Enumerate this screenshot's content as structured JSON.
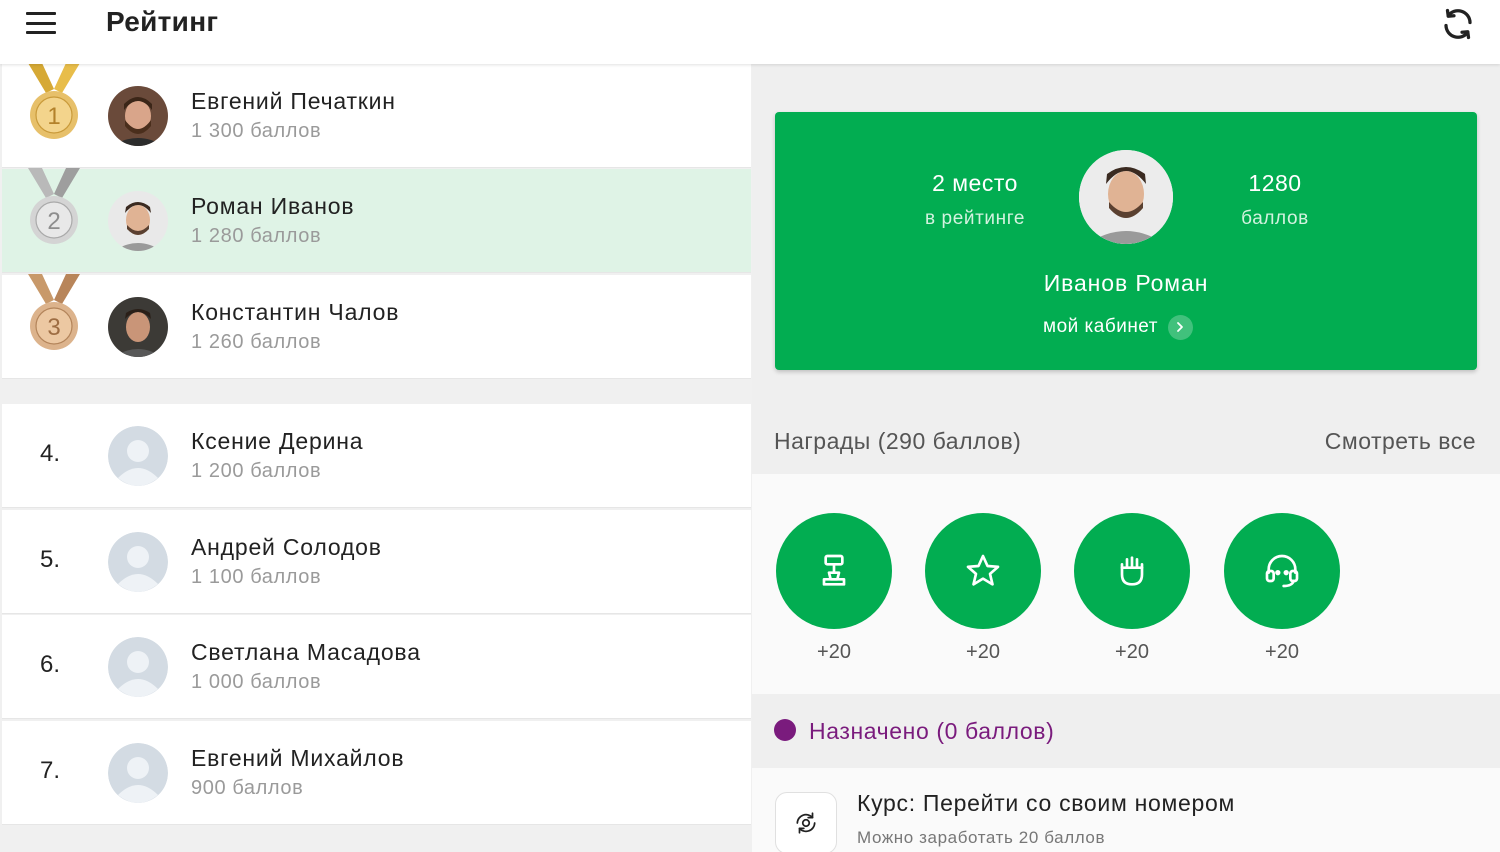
{
  "header": {
    "title": "Рейтинг",
    "menu_icon": "menu-icon",
    "refresh_icon": "refresh-icon"
  },
  "ranking": [
    {
      "place": "1",
      "name": "Евгений Печаткин",
      "score": "1 300 баллов",
      "medal": "gold"
    },
    {
      "place": "2",
      "name": "Роман Иванов",
      "score": "1 280 баллов",
      "medal": "silver",
      "current_user": true
    },
    {
      "place": "3",
      "name": "Константин Чалов",
      "score": "1 260 баллов",
      "medal": "bronze"
    },
    {
      "place": "4.",
      "name": "Ксение Дерина",
      "score": "1 200 баллов"
    },
    {
      "place": "5.",
      "name": "Андрей Солодов",
      "score": "1 100 баллов"
    },
    {
      "place": "6.",
      "name": "Светлана Масадова",
      "score": "1 000 баллов"
    },
    {
      "place": "7.",
      "name": "Евгений Михайлов",
      "score": "900 баллов"
    }
  ],
  "profile_card": {
    "place": "2 место",
    "place_label": "в рейтинге",
    "points": "1280",
    "points_label": "баллов",
    "name": "Иванов Роман",
    "cabinet_link": "мой кабинет"
  },
  "awards": {
    "title": "Награды (290 баллов)",
    "see_all": "Смотреть все",
    "items": [
      {
        "icon": "trophy-icon",
        "points": "+20"
      },
      {
        "icon": "star-icon",
        "points": "+20"
      },
      {
        "icon": "fist-icon",
        "points": "+20"
      },
      {
        "icon": "headset-icon",
        "points": "+20"
      }
    ]
  },
  "assigned": {
    "title": "Назначено (0 баллов)",
    "course_title": "Курс: Перейти со своим номером",
    "course_subtitle": "Можно заработать 20 баллов",
    "course_icon": "phone-transfer-icon"
  },
  "colors": {
    "brand_green": "#02ad51",
    "highlight_row": "#dff3e6",
    "assigned_purple": "#7a1b7d",
    "gold": "#e3b54a",
    "silver": "#c7c7c7",
    "bronze": "#d4a478"
  }
}
